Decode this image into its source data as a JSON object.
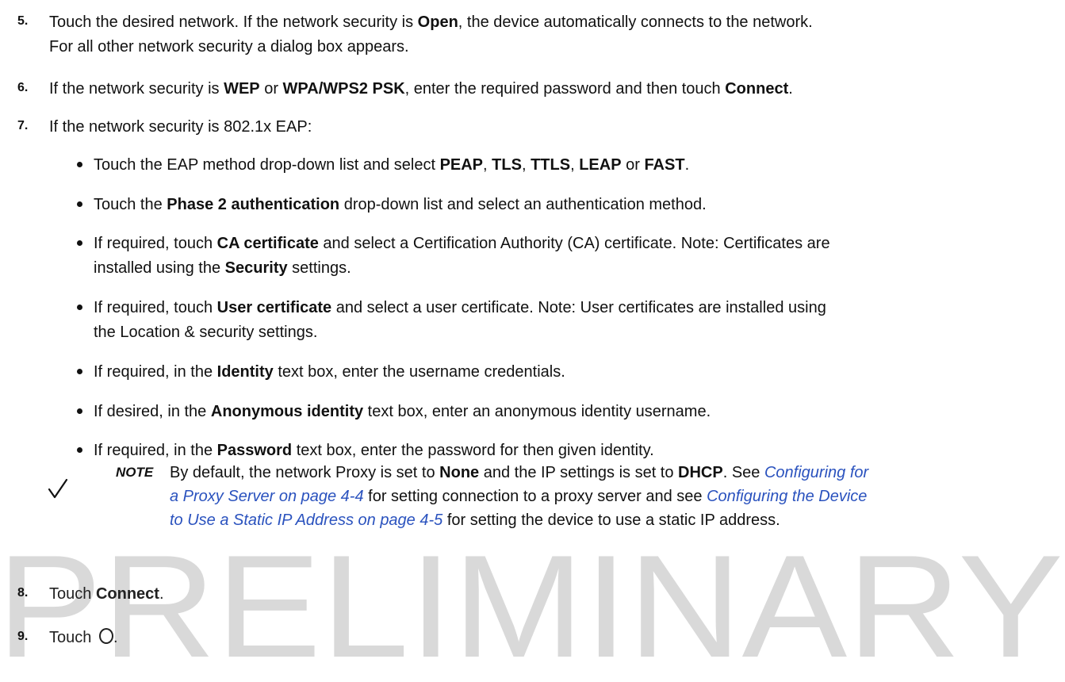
{
  "steps": {
    "s5": {
      "num": "5.",
      "line1_a": "Touch the desired network. If the network security is ",
      "line1_b": "Open",
      "line1_c": ", the device automatically connects to the network.",
      "line2": "For all other network security a dialog box appears."
    },
    "s6": {
      "num": "6.",
      "a": "If the network security is ",
      "b": "WEP",
      "c": " or ",
      "d": "WPA/WPS2 PSK",
      "e": ", enter the required password and then touch ",
      "f": "Connect",
      "g": "."
    },
    "s7": {
      "num": "7.",
      "text": "If the network security is 802.1x EAP:"
    },
    "s8": {
      "num": "8.",
      "a": "Touch ",
      "b": "Connect",
      "c": "."
    },
    "s9": {
      "num": "9.",
      "a": "Touch ",
      "b": ".",
      "icon": "circle-home-icon"
    }
  },
  "bullets": {
    "b1": {
      "a": "Touch the EAP method drop-down list and select ",
      "b": "PEAP",
      "c": ", ",
      "d": "TLS",
      "e": ", ",
      "f": "TTLS",
      "g": ", ",
      "h": "LEAP",
      "i": " or ",
      "j": "FAST",
      "k": "."
    },
    "b2": {
      "a": "Touch the ",
      "b": "Phase 2 authentication",
      "c": " drop-down list and select an authentication method."
    },
    "b3": {
      "a": "If required, touch ",
      "b": "CA certificate",
      "c": " and select a Certification Authority (CA) certificate. Note: Certificates are",
      "d": "installed using the ",
      "e": "Security",
      "f": " settings."
    },
    "b4": {
      "a": "If required, touch ",
      "b": "User certificate",
      "c": " and select a user certificate. Note: User certificates are installed using",
      "d": "the Location & security settings."
    },
    "b5": {
      "a": "If required, in the ",
      "b": "Identity",
      "c": " text box, enter the username credentials."
    },
    "b6": {
      "a": "If desired, in the ",
      "b": "Anonymous identity",
      "c": " text box, enter an anonymous identity username."
    },
    "b7": {
      "a": "If required, in the ",
      "b": "Password",
      "c": " text box, enter the password for then given identity."
    }
  },
  "note": {
    "label": "NOTE",
    "icon": "checkmark-icon",
    "l1_a": "By default, the network Proxy is set to ",
    "l1_b": "None",
    "l1_c": " and the IP settings is set to ",
    "l1_d": "DHCP",
    "l1_e": ". See ",
    "l1_link": "Configuring for",
    "l2_link1": "a Proxy Server on page 4-4",
    "l2_text": " for setting connection to a proxy server and see ",
    "l2_link2": "Configuring the Device",
    "l3_link": "to Use a Static IP Address on page 4-5",
    "l3_text": " for setting the device to use a static IP address."
  },
  "watermark": {
    "text": "PRELIMINARY",
    "color": "#d9d9d9"
  },
  "colors": {
    "link": "#2a52be",
    "text": "#111111"
  }
}
